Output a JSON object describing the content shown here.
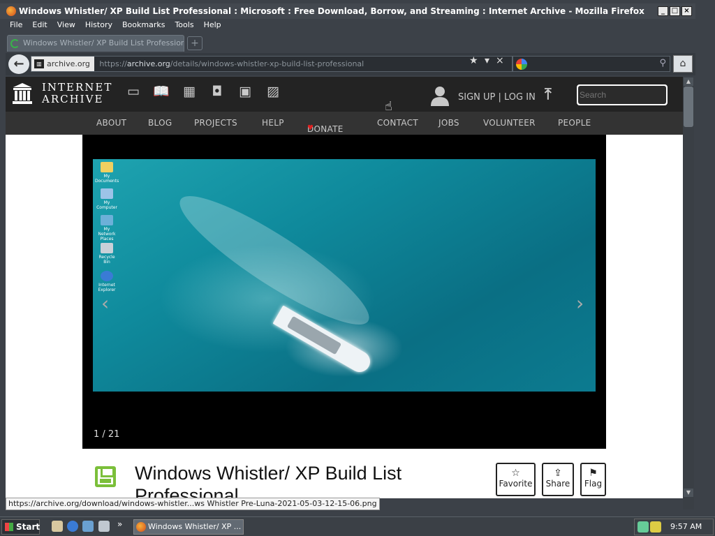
{
  "window": {
    "title": "Windows Whistler/ XP Build List Professional : Microsoft : Free Download, Borrow, and Streaming : Internet Archive - Mozilla Firefox",
    "minimize": "_",
    "maximize": "□",
    "close": "×"
  },
  "menu": [
    "File",
    "Edit",
    "View",
    "History",
    "Bookmarks",
    "Tools",
    "Help"
  ],
  "tab": {
    "label": "Windows Whistler/ XP Build List Professional",
    "new_tab": "+"
  },
  "navbar": {
    "back": "←",
    "site": "archive.org",
    "url_prefix": "https://",
    "url_host": "archive.org",
    "url_path": "/details/windows-whistler-xp-build-list-professional",
    "star": "★",
    "dropdown": "▾",
    "stop": "×",
    "search_placeholder": "",
    "home": "⌂"
  },
  "ia": {
    "logo_line1": "INTERNET",
    "logo_line2": "ARCHIVE",
    "media_icons": [
      "web-icon",
      "texts-icon",
      "video-icon",
      "audio-icon",
      "software-icon",
      "images-icon"
    ],
    "signup_login": "SIGN UP | LOG IN",
    "search_placeholder": "Search",
    "nav": [
      "ABOUT",
      "BLOG",
      "PROJECTS",
      "HELP",
      "DONATE",
      "CONTACT",
      "JOBS",
      "VOLUNTEER",
      "PEOPLE"
    ]
  },
  "viewer": {
    "counter": "1 / 21",
    "desktop_icons": [
      "My Documents",
      "My Computer",
      "My Network Places",
      "Recycle Bin",
      "Internet Explorer"
    ]
  },
  "item": {
    "title": "Windows Whistler/ XP Build List Professional",
    "favorite": "Favorite",
    "share": "Share",
    "flag": "Flag"
  },
  "status_bar": "https://archive.org/download/windows-whistler...ws Whistler Pre-Luna-2021-05-03-12-15-06.png",
  "taskbar": {
    "start": "Start",
    "task": "Windows Whistler/ XP ...",
    "clock": "9:57 AM"
  }
}
